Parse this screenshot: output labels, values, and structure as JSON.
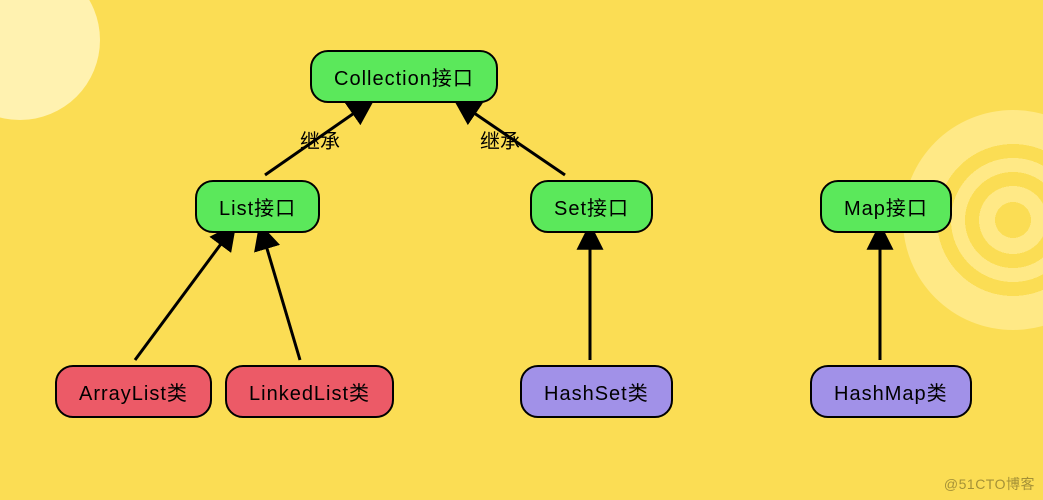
{
  "nodes": {
    "collection": {
      "label": "Collection接口",
      "color": "green"
    },
    "list": {
      "label": "List接口",
      "color": "green"
    },
    "set": {
      "label": "Set接口",
      "color": "green"
    },
    "map": {
      "label": "Map接口",
      "color": "green"
    },
    "arraylist": {
      "label": "ArrayList类",
      "color": "red"
    },
    "linkedlist": {
      "label": "LinkedList类",
      "color": "red"
    },
    "hashset": {
      "label": "HashSet类",
      "color": "purple"
    },
    "hashmap": {
      "label": "HashMap类",
      "color": "purple"
    }
  },
  "edges": [
    {
      "from": "list",
      "to": "collection",
      "label": "继承"
    },
    {
      "from": "set",
      "to": "collection",
      "label": "继承"
    },
    {
      "from": "arraylist",
      "to": "list"
    },
    {
      "from": "linkedlist",
      "to": "list"
    },
    {
      "from": "hashset",
      "to": "set"
    },
    {
      "from": "hashmap",
      "to": "map"
    }
  ],
  "watermark": "@51CTO博客"
}
